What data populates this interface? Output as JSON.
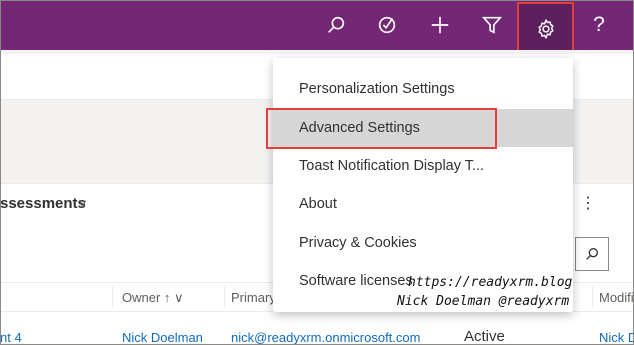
{
  "topbar": {
    "background": "#742774",
    "icons": [
      "search-icon",
      "assistant-icon",
      "plus-icon",
      "filter-icon",
      "settings-icon",
      "help-icon"
    ],
    "help_label": "?"
  },
  "view": {
    "title": "ssessments",
    "chevron": "∨",
    "more": "⋮"
  },
  "columns": [
    {
      "label": "Owner ↑ ∨"
    },
    {
      "label": "Primary"
    },
    {
      "label": "Modifi"
    }
  ],
  "row": {
    "name": "nt 4",
    "owner": "Nick Doelman",
    "email": "nick@readyxrm.onmicrosoft.com",
    "status": "Active",
    "modified": "Nick D"
  },
  "settings_menu": {
    "items": [
      {
        "label": "Personalization Settings",
        "selected": false
      },
      {
        "label": "Advanced Settings",
        "selected": true
      },
      {
        "label": "Toast Notification Display T...",
        "selected": false
      },
      {
        "label": "About",
        "selected": false
      },
      {
        "label": "Privacy & Cookies",
        "selected": false
      },
      {
        "label": "Software licenses",
        "selected": false
      }
    ]
  },
  "watermark": {
    "line1": "https://readyxrm.blog",
    "line2": "Nick Doelman @readyxrm"
  },
  "colors": {
    "accent": "#742774",
    "highlight_border": "#e53e3e",
    "link": "#0f6cbd"
  }
}
